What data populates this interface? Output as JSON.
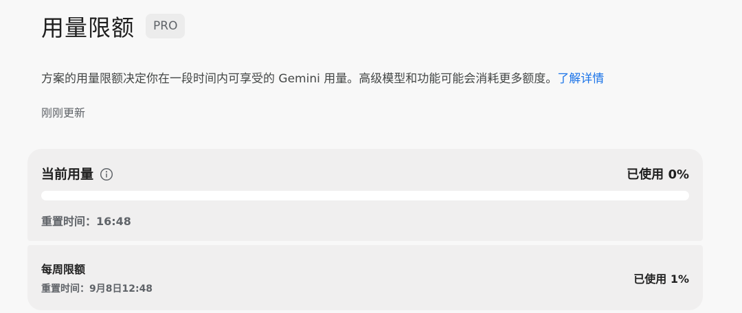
{
  "header": {
    "title": "用量限额",
    "plan_badge": "PRO"
  },
  "description": {
    "text": "方案的用量限额决定你在一段时间内可享受的 Gemini 用量。高级模型和功能可能会消耗更多额度。",
    "link_label": "了解详情"
  },
  "updated_text": "刚刚更新",
  "current_usage": {
    "title": "当前用量",
    "info_icon": "info-icon",
    "used_label": "已使用 0%",
    "used_percent": 0,
    "reset_label": "重置时间：16:48"
  },
  "weekly_limit": {
    "title": "每周限额",
    "used_label": "已使用 1%",
    "used_percent": 1,
    "reset_label": "重置时间：9月8日12:48"
  },
  "colors": {
    "background": "#f8f8f8",
    "card": "#f0efef",
    "link": "#1a73e8",
    "track": "#ffffff"
  }
}
